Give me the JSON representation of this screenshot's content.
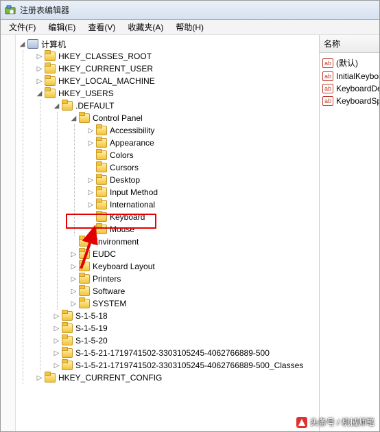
{
  "window": {
    "title": "注册表编辑器"
  },
  "menu": {
    "file": "文件(F)",
    "edit": "编辑(E)",
    "view": "查看(V)",
    "favorites": "收藏夹(A)",
    "help": "帮助(H)"
  },
  "tree": {
    "root": "计算机",
    "hkcr": "HKEY_CLASSES_ROOT",
    "hkcu": "HKEY_CURRENT_USER",
    "hklm": "HKEY_LOCAL_MACHINE",
    "hku": "HKEY_USERS",
    "default": ".DEFAULT",
    "cp": "Control Panel",
    "accessibility": "Accessibility",
    "appearance": "Appearance",
    "colors": "Colors",
    "cursors": "Cursors",
    "desktop": "Desktop",
    "input": "Input Method",
    "intl": "International",
    "keyboard": "Keyboard",
    "mouse": "Mouse",
    "environment": "Environment",
    "eudc": "EUDC",
    "kbdlayout": "Keyboard Layout",
    "printers": "Printers",
    "software": "Software",
    "system": "SYSTEM",
    "s18": "S-1-5-18",
    "s19": "S-1-5-19",
    "s20": "S-1-5-20",
    "sid1": "S-1-5-21-1719741502-3303105245-4062766889-500",
    "sid2": "S-1-5-21-1719741502-3303105245-4062766889-500_Classes",
    "hkcc": "HKEY_CURRENT_CONFIG"
  },
  "right": {
    "header": "名称",
    "v0": "(默认)",
    "v1": "InitialKeyboa",
    "v2": "KeyboardDe",
    "v3": "KeyboardSpe"
  },
  "watermark": "头条号 / 机械师笔"
}
